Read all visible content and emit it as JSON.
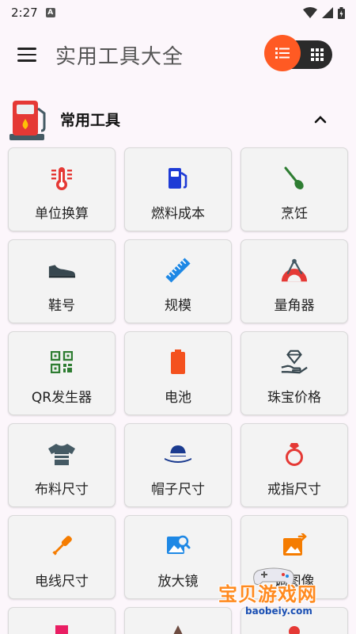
{
  "status": {
    "time": "2:27",
    "badge": "A"
  },
  "app_bar": {
    "title": "实用工具大全"
  },
  "section": {
    "title": "常用工具"
  },
  "tools": [
    {
      "label": "单位换算"
    },
    {
      "label": "燃料成本"
    },
    {
      "label": "烹饪"
    },
    {
      "label": "鞋号"
    },
    {
      "label": "规模"
    },
    {
      "label": "量角器"
    },
    {
      "label": "QR发生器"
    },
    {
      "label": "电池"
    },
    {
      "label": "珠宝价格"
    },
    {
      "label": "布料尺寸"
    },
    {
      "label": "帽子尺寸"
    },
    {
      "label": "戒指尺寸"
    },
    {
      "label": "电线尺寸"
    },
    {
      "label": "放大镜"
    },
    {
      "label": "调图像"
    }
  ],
  "watermark": {
    "text": "宝贝游戏网",
    "url": "baobeiy.com"
  },
  "colors": {
    "accent": "#ff5a23",
    "red": "#e53935",
    "blue": "#1e88e5",
    "green": "#2e7d32",
    "orange": "#f57c00"
  }
}
